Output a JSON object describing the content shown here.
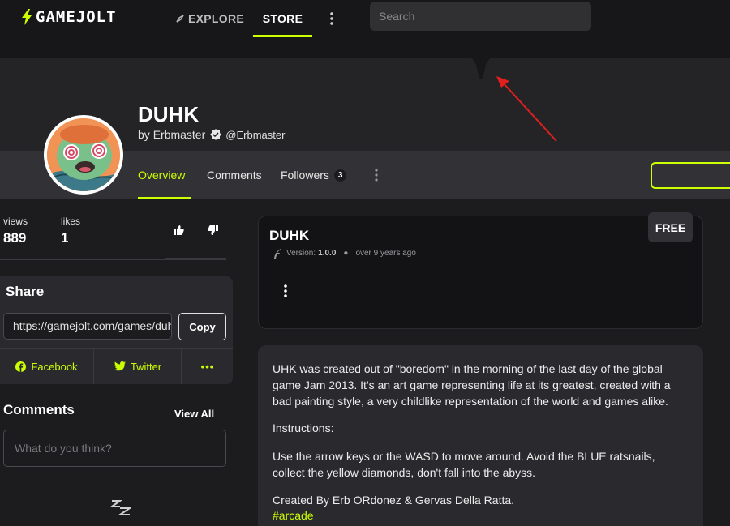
{
  "nav": {
    "logo_text": "GAMEJOLT",
    "explore_label": "EXPLORE",
    "store_label": "STORE",
    "search_placeholder": "Search"
  },
  "game": {
    "title": "DUHK",
    "by_prefix": "by",
    "developer": "Erbmaster",
    "handle": "@Erbmaster"
  },
  "tabs": [
    {
      "label": "Overview"
    },
    {
      "label": "Comments"
    },
    {
      "label": "Followers",
      "count": "3"
    }
  ],
  "stats": {
    "views_label": "views",
    "views_value": "889",
    "likes_label": "likes",
    "likes_value": "1"
  },
  "share": {
    "title": "Share",
    "url": "https://gamejolt.com/games/duhk",
    "copy_label": "Copy",
    "facebook_label": "Facebook",
    "twitter_label": "Twitter",
    "more_label": "•••"
  },
  "comments": {
    "title": "Comments",
    "view_all_label": "View All",
    "placeholder": "What do you think?"
  },
  "build": {
    "price_tag": "FREE",
    "title": "DUHK",
    "version_label": "Version:",
    "version_value": "1.0.0",
    "age": "over 9 years ago"
  },
  "description": {
    "p1": "UHK was created out of \"boredom\" in the morning of the last day of the global game Jam 2013. It's an art game representing life at its greatest, created with a bad painting style, a very childlike representation of the world and games alike.",
    "p2": "Instructions:",
    "p3": "Use the arrow keys or the WASD to move around. Avoid the BLUE ratsnails, collect the yellow diamonds, don't fall into the abyss.",
    "p4": "Created By Erb ORdonez & Gervas Della Ratta.",
    "tag": "#arcade"
  },
  "colors": {
    "accent": "#ccff00",
    "background": "#1c1c1f",
    "annotation_arrow": "#e02020"
  }
}
